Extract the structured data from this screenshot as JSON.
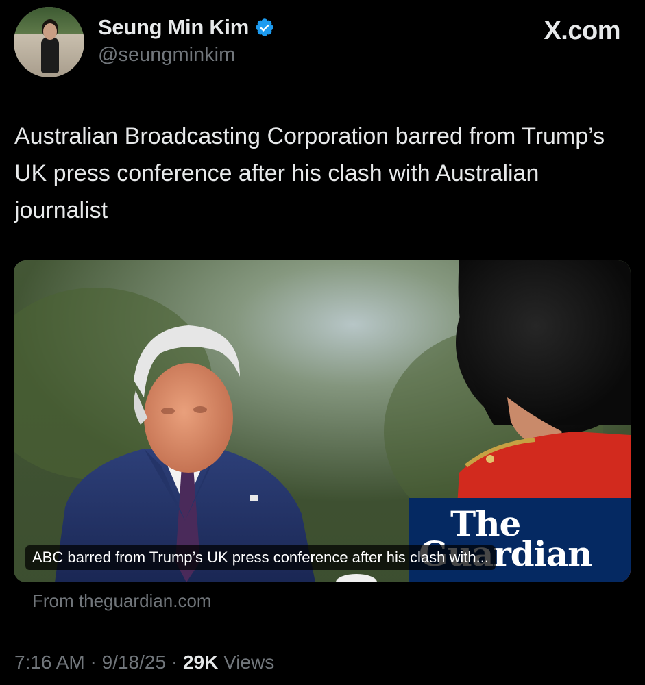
{
  "author": {
    "display_name": "Seung Min Kim",
    "handle": "@seungminkim",
    "verified": true,
    "verified_color": "#1d9bf0"
  },
  "site_mark": "X.com",
  "tweet": {
    "text": "Australian Broadcasting Corporation barred from Trump’s UK press conference after his clash with Australian journalist"
  },
  "link_card": {
    "caption": "ABC barred from Trump’s UK press conference after his clash with...",
    "source": "From theguardian.com",
    "logo_lines": [
      "The",
      "Guardian"
    ],
    "logo_bg": "#052962"
  },
  "meta": {
    "time": "7:16 AM",
    "separator": " · ",
    "date": "9/18/25",
    "views_count": "29K",
    "views_label": " Views"
  },
  "colors": {
    "background": "#000000",
    "primary_text": "#e7e9ea",
    "secondary_text": "#71767b"
  }
}
